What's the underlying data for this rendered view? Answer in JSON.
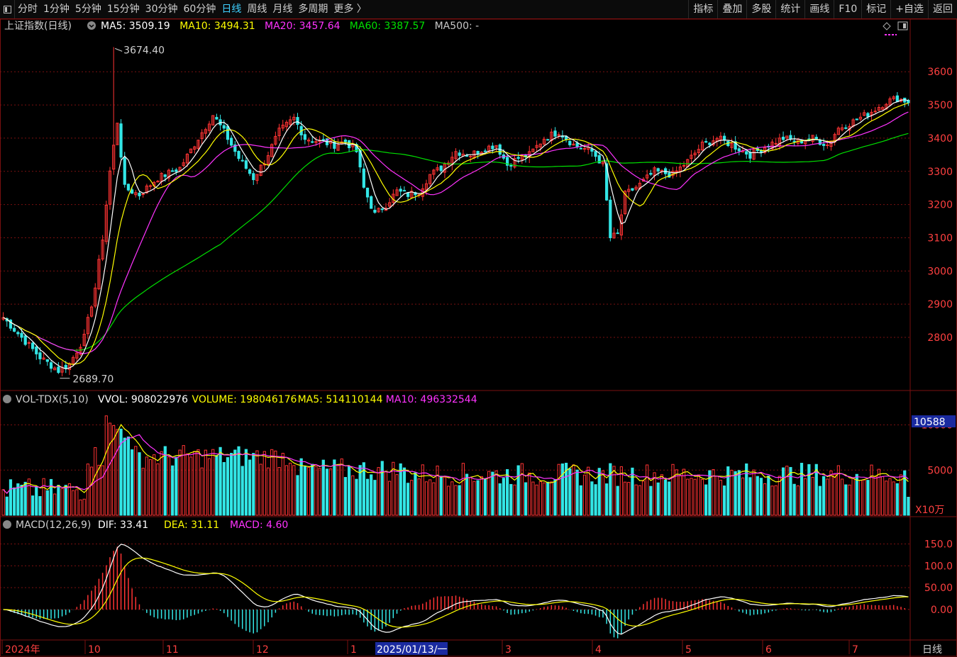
{
  "toolbar": {
    "periods": [
      {
        "label": "分时",
        "active": false
      },
      {
        "label": "1分钟",
        "active": false
      },
      {
        "label": "5分钟",
        "active": false
      },
      {
        "label": "15分钟",
        "active": false
      },
      {
        "label": "30分钟",
        "active": false
      },
      {
        "label": "60分钟",
        "active": false
      },
      {
        "label": "日线",
        "active": true
      },
      {
        "label": "周线",
        "active": false
      },
      {
        "label": "月线",
        "active": false
      },
      {
        "label": "多周期",
        "active": false
      },
      {
        "label": "更多 〉",
        "active": false
      }
    ],
    "tools": [
      "指标",
      "叠加",
      "多股",
      "统计",
      "画线",
      "F10",
      "标记",
      "+自选",
      "返回"
    ]
  },
  "main": {
    "title": "上证指数(日线)",
    "ma_labels": [
      {
        "text": "MA5: 3509.19",
        "color": "#ffffff"
      },
      {
        "text": "MA10: 3494.31",
        "color": "#ffff00"
      },
      {
        "text": "MA20: 3457.64",
        "color": "#ff33ff"
      },
      {
        "text": "MA60: 3387.57",
        "color": "#00e000"
      },
      {
        "text": "MA500: -",
        "color": "#c8c8c8"
      }
    ],
    "high_label": "3674.40",
    "low_label": "2689.70",
    "yaxis": [
      "3600",
      "3500",
      "3400",
      "3300",
      "3200",
      "3100",
      "3000",
      "2900",
      "2800"
    ]
  },
  "volume": {
    "title": "VOL-TDX(5,10)",
    "labels": [
      {
        "text": "VVOL: 908022976",
        "color": "#ffffff"
      },
      {
        "text": "VOLUME: 198046176",
        "color": "#ffff00"
      },
      {
        "text": "MA5: 514110144",
        "color": "#ffff00"
      },
      {
        "text": "MA10: 496332544",
        "color": "#ff33ff"
      }
    ],
    "yaxis": [
      "10000",
      "5000"
    ],
    "badge": "10588",
    "unit": "X10万"
  },
  "macd": {
    "title": "MACD(12,26,9)",
    "labels": [
      {
        "text": "DIF: 33.41",
        "color": "#ffffff"
      },
      {
        "text": "DEA: 31.11",
        "color": "#ffff00"
      },
      {
        "text": "MACD: 4.60",
        "color": "#ff33ff"
      }
    ],
    "yaxis": [
      "150.0",
      "100.0",
      "50.00",
      "0.00"
    ]
  },
  "xaxis": {
    "labels": [
      "2024年",
      "10",
      "11",
      "12",
      "1",
      "3",
      "4",
      "5",
      "6",
      "7"
    ],
    "cursor_date": "2025/01/13/一",
    "period": "日线"
  },
  "colors": {
    "up": "#ff3333",
    "down": "#33e6e6",
    "grid": "#7a1010",
    "axis_text": "#ff4040"
  },
  "chart_data": {
    "type": "candlestick",
    "anchors_close": [
      [
        0,
        2860
      ],
      [
        5,
        2800
      ],
      [
        10,
        2740
      ],
      [
        15,
        2700
      ],
      [
        18,
        2720
      ],
      [
        22,
        2800
      ],
      [
        25,
        2950
      ],
      [
        27,
        3100
      ],
      [
        29,
        3300
      ],
      [
        31,
        3450
      ],
      [
        33,
        3250
      ],
      [
        37,
        3230
      ],
      [
        42,
        3280
      ],
      [
        48,
        3310
      ],
      [
        53,
        3400
      ],
      [
        57,
        3470
      ],
      [
        60,
        3420
      ],
      [
        64,
        3340
      ],
      [
        68,
        3280
      ],
      [
        71,
        3330
      ],
      [
        75,
        3420
      ],
      [
        79,
        3460
      ],
      [
        82,
        3400
      ],
      [
        86,
        3390
      ],
      [
        90,
        3380
      ],
      [
        93,
        3390
      ],
      [
        96,
        3360
      ],
      [
        98,
        3250
      ],
      [
        101,
        3170
      ],
      [
        104,
        3200
      ],
      [
        107,
        3240
      ],
      [
        110,
        3230
      ],
      [
        113,
        3240
      ],
      [
        116,
        3290
      ],
      [
        119,
        3310
      ],
      [
        123,
        3360
      ],
      [
        127,
        3350
      ],
      [
        131,
        3370
      ],
      [
        134,
        3380
      ],
      [
        137,
        3320
      ],
      [
        140,
        3340
      ],
      [
        143,
        3350
      ],
      [
        147,
        3400
      ],
      [
        151,
        3420
      ],
      [
        155,
        3380
      ],
      [
        160,
        3360
      ],
      [
        163,
        3320
      ],
      [
        165,
        3100
      ],
      [
        167,
        3110
      ],
      [
        169,
        3230
      ],
      [
        173,
        3260
      ],
      [
        177,
        3300
      ],
      [
        182,
        3290
      ],
      [
        186,
        3330
      ],
      [
        190,
        3380
      ],
      [
        194,
        3400
      ],
      [
        198,
        3380
      ],
      [
        203,
        3350
      ],
      [
        208,
        3380
      ],
      [
        212,
        3400
      ],
      [
        216,
        3390
      ],
      [
        220,
        3400
      ],
      [
        224,
        3380
      ],
      [
        227,
        3430
      ],
      [
        231,
        3450
      ],
      [
        236,
        3480
      ],
      [
        240,
        3510
      ],
      [
        243,
        3520
      ],
      [
        246,
        3510
      ]
    ],
    "total_days": 247,
    "extremes": {
      "high": 3674.4,
      "low": 2689.7
    },
    "volume_scale_max": 12000,
    "macd_range": [
      -60,
      180
    ]
  }
}
